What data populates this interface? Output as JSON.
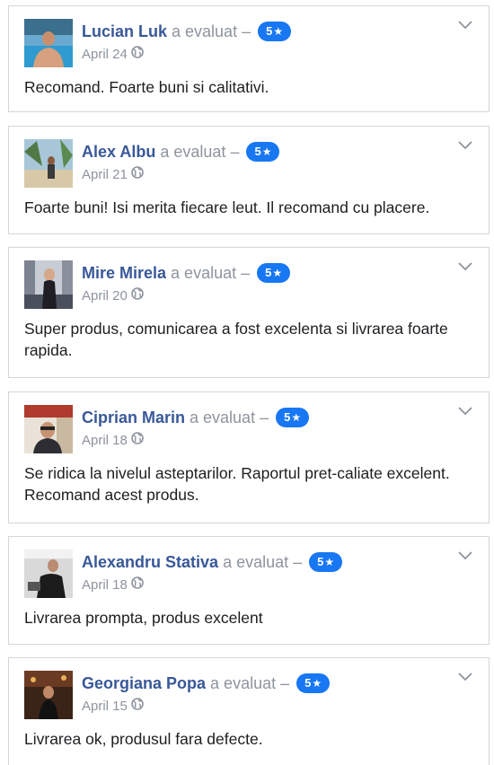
{
  "reviews": [
    {
      "name": "Lucian Luk",
      "action": "a evaluat",
      "separator": "–",
      "rating": "5",
      "date": "April 24",
      "text": "Recomand. Foarte buni si calitativi."
    },
    {
      "name": "Alex Albu",
      "action": "a evaluat",
      "separator": "–",
      "rating": "5",
      "date": "April 21",
      "text": "Foarte buni! Isi merita fiecare leut. Il recomand cu placere."
    },
    {
      "name": "Mire Mirela",
      "action": "a evaluat",
      "separator": "–",
      "rating": "5",
      "date": "April 20",
      "text": "Super produs, comunicarea a fost excelenta si livrarea foarte rapida."
    },
    {
      "name": "Ciprian Marin",
      "action": "a evaluat",
      "separator": "–",
      "rating": "5",
      "date": "April 18",
      "text": "Se ridica la nivelul asteptarilor. Raportul pret-caliate excelent. Recomand acest produs."
    },
    {
      "name": "Alexandru Stativa",
      "action": "a evaluat",
      "separator": "–",
      "rating": "5",
      "date": "April 18",
      "text": "Livrarea prompta, produs excelent"
    },
    {
      "name": "Georgiana Popa",
      "action": "a evaluat",
      "separator": "–",
      "rating": "5",
      "date": "April 15",
      "text": "Livrarea ok, produsul fara defecte."
    }
  ],
  "icons": {
    "star": "★",
    "globe": "globe-icon",
    "menu": "chevron-down-icon"
  },
  "colors": {
    "name": "#385898",
    "muted": "#8d949e",
    "badge": "#1877f2",
    "text": "#1c1e21",
    "border": "#d3d6db"
  }
}
